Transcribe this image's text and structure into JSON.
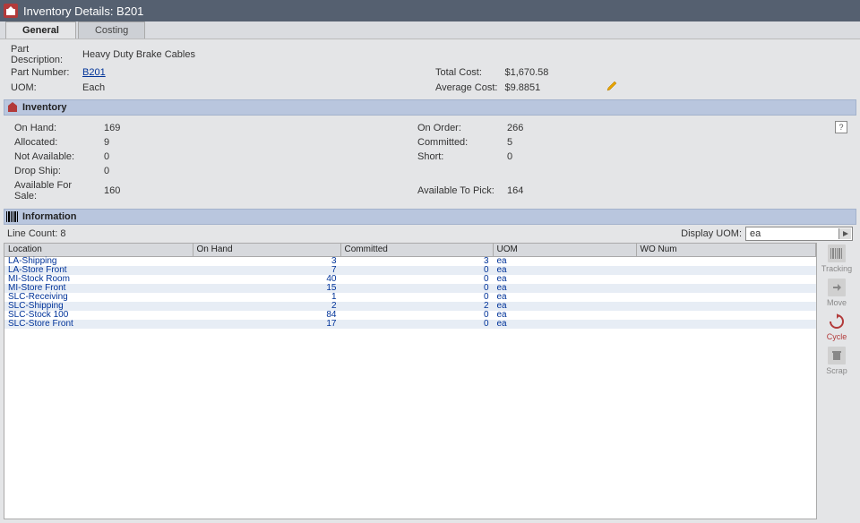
{
  "title": "Inventory Details: B201",
  "tabs": {
    "general": "General",
    "costing": "Costing"
  },
  "part": {
    "desc_label": "Part Description:",
    "desc_value": "Heavy Duty Brake Cables",
    "num_label": "Part Number:",
    "num_value": "B201",
    "uom_label": "UOM:",
    "uom_value": "Each",
    "total_cost_label": "Total Cost:",
    "total_cost_value": "$1,670.58",
    "avg_cost_label": "Average Cost:",
    "avg_cost_value": "$9.8851"
  },
  "sections": {
    "inventory": "Inventory",
    "information": "Information"
  },
  "inventory": {
    "on_hand_label": "On Hand:",
    "on_hand": "169",
    "allocated_label": "Allocated:",
    "allocated": "9",
    "not_available_label": "Not Available:",
    "not_available": "0",
    "drop_ship_label": "Drop Ship:",
    "drop_ship": "0",
    "avail_sale_label": "Available For Sale:",
    "avail_sale": "160",
    "on_order_label": "On Order:",
    "on_order": "266",
    "committed_label": "Committed:",
    "committed": "5",
    "short_label": "Short:",
    "short": "0",
    "avail_pick_label": "Available To Pick:",
    "avail_pick": "164"
  },
  "info": {
    "line_count_label": "Line Count:",
    "line_count": "8",
    "display_uom_label": "Display UOM:",
    "display_uom": "ea"
  },
  "table": {
    "headers": {
      "location": "Location",
      "on_hand": "On Hand",
      "committed": "Committed",
      "uom": "UOM",
      "wo_num": "WO Num"
    },
    "rows": [
      {
        "loc": "LA-Shipping",
        "onh": "3",
        "com": "3",
        "uom": "ea",
        "wo": ""
      },
      {
        "loc": "LA-Store Front",
        "onh": "7",
        "com": "0",
        "uom": "ea",
        "wo": ""
      },
      {
        "loc": "MI-Stock Room",
        "onh": "40",
        "com": "0",
        "uom": "ea",
        "wo": ""
      },
      {
        "loc": "MI-Store Front",
        "onh": "15",
        "com": "0",
        "uom": "ea",
        "wo": ""
      },
      {
        "loc": "SLC-Receiving",
        "onh": "1",
        "com": "0",
        "uom": "ea",
        "wo": ""
      },
      {
        "loc": "SLC-Shipping",
        "onh": "2",
        "com": "2",
        "uom": "ea",
        "wo": ""
      },
      {
        "loc": "SLC-Stock 100",
        "onh": "84",
        "com": "0",
        "uom": "ea",
        "wo": ""
      },
      {
        "loc": "SLC-Store Front",
        "onh": "17",
        "com": "0",
        "uom": "ea",
        "wo": ""
      }
    ]
  },
  "sidebar": {
    "tracking": "Tracking",
    "move": "Move",
    "cycle": "Cycle",
    "scrap": "Scrap"
  },
  "help_text": "?"
}
